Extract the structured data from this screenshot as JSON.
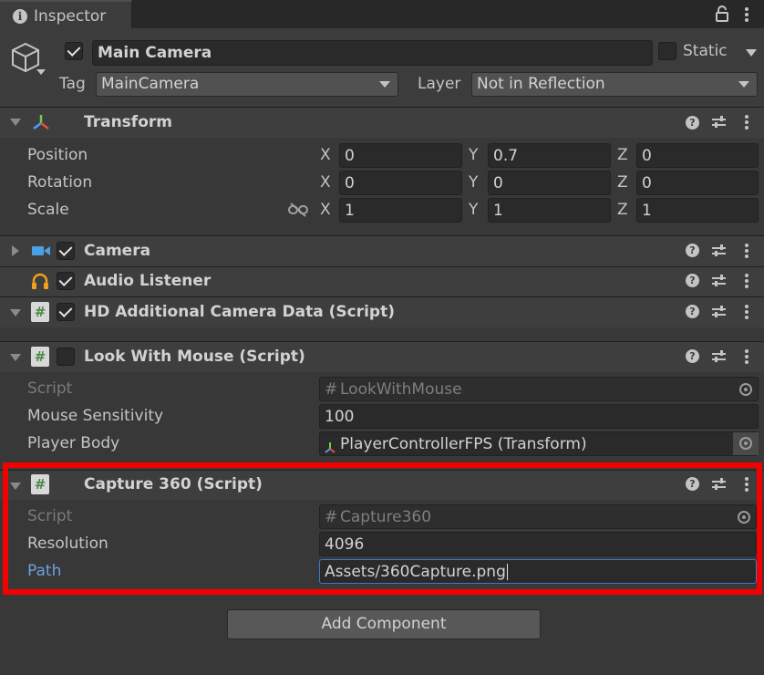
{
  "tab": {
    "title": "Inspector"
  },
  "object": {
    "name": "Main Camera",
    "active": true,
    "static_label": "Static",
    "tag_label": "Tag",
    "tag_value": "MainCamera",
    "layer_label": "Layer",
    "layer_value": "Not in Reflection"
  },
  "transform": {
    "title": "Transform",
    "position_label": "Position",
    "rotation_label": "Rotation",
    "scale_label": "Scale",
    "axes": [
      "X",
      "Y",
      "Z"
    ],
    "position": [
      "0",
      "0.7",
      "0"
    ],
    "rotation": [
      "0",
      "0",
      "0"
    ],
    "scale": [
      "1",
      "1",
      "1"
    ]
  },
  "camera": {
    "title": "Camera",
    "enabled": true
  },
  "audio_listener": {
    "title": "Audio Listener",
    "enabled": true
  },
  "hd_camera": {
    "title": "HD Additional Camera Data (Script)",
    "enabled": true
  },
  "look_with_mouse": {
    "title": "Look With Mouse (Script)",
    "enabled": false,
    "script_label": "Script",
    "script_value": "LookWithMouse",
    "sensitivity_label": "Mouse Sensitivity",
    "sensitivity_value": "100",
    "player_body_label": "Player Body",
    "player_body_value": "PlayerControllerFPS (Transform)"
  },
  "capture360": {
    "title": "Capture 360 (Script)",
    "script_label": "Script",
    "script_value": "Capture360",
    "resolution_label": "Resolution",
    "resolution_value": "4096",
    "path_label": "Path",
    "path_value": "Assets/360Capture.png"
  },
  "add_component": {
    "label": "Add Component"
  },
  "colors": {
    "highlight_border": "#f40000",
    "path_label": "#6f9fe0",
    "background": "#383838"
  }
}
